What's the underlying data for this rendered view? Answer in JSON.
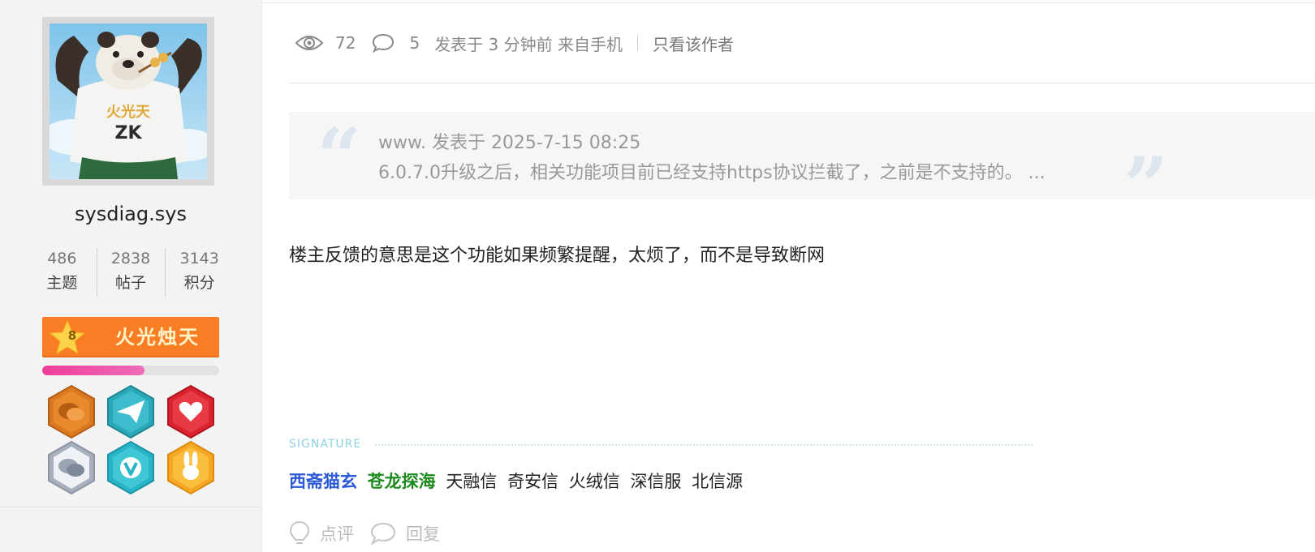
{
  "profile": {
    "username": "sysdiag.sys",
    "stats": [
      {
        "value": "486",
        "label": "主题"
      },
      {
        "value": "2838",
        "label": "帖子"
      },
      {
        "value": "3143",
        "label": "积分"
      }
    ],
    "rank": {
      "level": "8",
      "title": "火光烛天",
      "progress_percent": 58,
      "color": "#f97d24",
      "progress_color": "#ee3d9a"
    },
    "medals": [
      {
        "icon": "chat-bubble-medal-icon",
        "color": "#d9781f"
      },
      {
        "icon": "paper-plane-medal-icon",
        "color": "#2aa8b8"
      },
      {
        "icon": "heart-medal-icon",
        "color": "#d9232e"
      },
      {
        "icon": "double-chat-medal-icon",
        "color": "#a8b0bd"
      },
      {
        "icon": "v-verified-medal-icon",
        "color": "#27b4c6"
      },
      {
        "icon": "rabbit-medal-icon",
        "color": "#f5a623"
      }
    ]
  },
  "meta": {
    "views": "72",
    "comments": "5",
    "posted": "发表于 3 分钟前 来自手机",
    "only_author": "只看该作者"
  },
  "quote": {
    "header": "www. 发表于 2025-7-15 08:25",
    "text": "6.0.7.0升级之后，相关功能项目前已经支持https协议拦截了，之前是不支持的。 ..."
  },
  "post": {
    "body": "楼主反馈的意思是这个功能如果频繁提醒，太烦了，而不是导致断网"
  },
  "signature": {
    "label": "SIGNATURE",
    "links": [
      {
        "text": "西斋猫玄",
        "style": "blue"
      },
      {
        "text": "苍龙探海",
        "style": "green"
      },
      {
        "text": "天融信",
        "style": "plain"
      },
      {
        "text": "奇安信",
        "style": "plain"
      },
      {
        "text": "火绒信",
        "style": "plain"
      },
      {
        "text": "深信服",
        "style": "plain"
      },
      {
        "text": "北信源",
        "style": "plain"
      }
    ]
  },
  "actions": {
    "rate_label": "点评",
    "reply_label": "回复"
  }
}
